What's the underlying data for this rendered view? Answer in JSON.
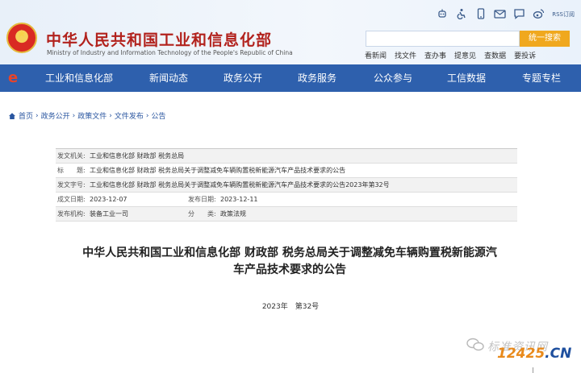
{
  "header": {
    "title": "中华人民共和国工业和信息化部",
    "subtitle": "Ministry of Industry and Information Technology of the People's Republic of China",
    "rss_label": "RSS订阅",
    "search_placeholder": "",
    "search_button": "统一搜索",
    "quick_links": [
      "看新闻",
      "找文件",
      "查办事",
      "提意见",
      "查数据",
      "要投诉"
    ],
    "top_icons": [
      "robot-icon",
      "accessibility-icon",
      "mobile-icon",
      "mail-icon",
      "message-icon",
      "weibo-icon",
      "rss-icon"
    ]
  },
  "nav": {
    "items": [
      "工业和信息化部",
      "新闻动态",
      "政务公开",
      "政务服务",
      "公众参与",
      "工信数据",
      "专题专栏"
    ]
  },
  "breadcrumb": [
    "首页",
    "政务公开",
    "政策文件",
    "文件发布",
    "公告"
  ],
  "info": {
    "issuer_label": "发文机关:",
    "issuer_value": "工业和信息化部  财政部  税务总局",
    "title_label": "标　　题:",
    "title_value": "工业和信息化部 财政部 税务总局关于调整减免车辆购置税新能源汽车产品技术要求的公告",
    "docno_label": "发文字号:",
    "docno_value": "工业和信息化部 财政部 税务总局关于调整减免车辆购置税新能源汽车产品技术要求的公告2023年第32号",
    "created_label": "成文日期:",
    "created_value": "2023-12-07",
    "published_label": "发布日期:",
    "published_value": "2023-12-11",
    "org_label": "发布机构:",
    "org_value": "装备工业一司",
    "category_label": "分　　类:",
    "category_value": "政策法规"
  },
  "document": {
    "title_line1": "中华人民共和国工业和信息化部 财政部 税务总局关于调整减免车辆购置税新能源汽",
    "title_line2": "车产品技术要求的公告",
    "number": "2023年　第32号"
  },
  "watermark": {
    "text": "标准资讯网",
    "url_part1": "12425",
    "url_part2": ".CN"
  },
  "colors": {
    "nav_blue": "#2e60ad",
    "title_red": "#b2221d",
    "search_orange": "#f0a81e",
    "link_blue": "#2a56a0"
  }
}
